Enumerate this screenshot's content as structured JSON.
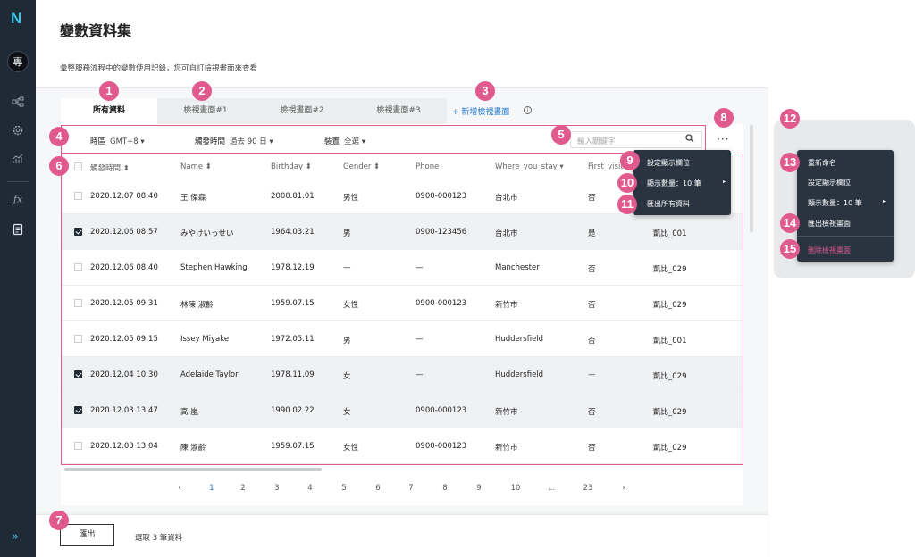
{
  "sidebar": {
    "logo": "N",
    "avatar": "專",
    "icons": [
      "flow-icon",
      "gear-icon",
      "chart-icon",
      "function-icon",
      "document-icon"
    ],
    "expand": "»"
  },
  "header": {
    "title": "變數資料集",
    "description": "彙整服務流程中的變數使用記錄，您可自訂檢視畫面來查看"
  },
  "tabs": [
    {
      "label": "所有資料"
    },
    {
      "label": "檢視畫面#1"
    },
    {
      "label": "檢視畫面#2"
    },
    {
      "label": "檢視畫面#3"
    }
  ],
  "add_view": "+ 新增檢視畫面",
  "filters": {
    "tz_label": "時區",
    "tz_value": "GMT+8 ▾",
    "time_label": "觸發時間",
    "time_value": "過去 90 日 ▾",
    "device_label": "裝置",
    "device_value": "全選 ▾"
  },
  "search": {
    "placeholder": "輸入關鍵字"
  },
  "more": "···",
  "table": {
    "headers": [
      "觸發時間 ⬍",
      "Name ⬍",
      "Birthday ⬍",
      "Gender ⬍",
      "Phone",
      "Where_you_stay ▾",
      "First_visit"
    ],
    "rows": [
      {
        "checked": false,
        "time": "2020.12.07  08:40",
        "name": "王 傑森",
        "birthday": "2000.01.01",
        "gender": "男性",
        "phone": "0900-000123",
        "stay": "台北市",
        "first": "否",
        "extra": ""
      },
      {
        "checked": true,
        "time": "2020.12.06  08:57",
        "name": "みやけいっせい",
        "birthday": "1964.03.21",
        "gender": "男",
        "phone": "0900-123456",
        "stay": "台北市",
        "first": "是",
        "extra": "凱比_001"
      },
      {
        "checked": false,
        "time": "2020.12.06  08:40",
        "name": "Stephen Hawking",
        "birthday": "1978.12.19",
        "gender": "—",
        "phone": "—",
        "stay": "Manchester",
        "first": "否",
        "extra": "凱比_029"
      },
      {
        "checked": false,
        "time": "2020.12.05  09:31",
        "name": "林陳 淑齡",
        "birthday": "1959.07.15",
        "gender": "女性",
        "phone": "0900-000123",
        "stay": "新竹市",
        "first": "否",
        "extra": "凱比_029"
      },
      {
        "checked": false,
        "time": "2020.12.05  09:15",
        "name": "Issey Miyake",
        "birthday": "1972.05.11",
        "gender": "男",
        "phone": "—",
        "stay": "Huddersfield",
        "first": "否",
        "extra": "凱比_001"
      },
      {
        "checked": true,
        "time": "2020.12.04  10:30",
        "name": "Adelaide Taylor",
        "birthday": "1978.11.09",
        "gender": "女",
        "phone": "—",
        "stay": "Huddersfield",
        "first": "—",
        "extra": "凱比_029"
      },
      {
        "checked": true,
        "time": "2020.12.03  13:47",
        "name": "高 嵐",
        "birthday": "1990.02.22",
        "gender": "女",
        "phone": "0900-000123",
        "stay": "新竹市",
        "first": "否",
        "extra": "凱比_029"
      },
      {
        "checked": false,
        "time": "2020.12.03  13:04",
        "name": "陳 淑齡",
        "birthday": "1959.07.15",
        "gender": "女性",
        "phone": "0900-000123",
        "stay": "新竹市",
        "first": "否",
        "extra": "凱比_029"
      }
    ]
  },
  "pagination": {
    "prev": "‹",
    "pages": [
      "1",
      "2",
      "3",
      "4",
      "5",
      "6",
      "7",
      "8",
      "9",
      "10",
      "...",
      "23"
    ],
    "next": "›"
  },
  "footer": {
    "export": "匯出",
    "selected": "選取 3 筆資料"
  },
  "menu_more": [
    "設定顯示欄位",
    "顯示數量：10 筆",
    "匯出所有資料"
  ],
  "menu_view": [
    "重新命名",
    "設定顯示欄位",
    "顯示數量：10 筆",
    "匯出檢視畫面",
    "刪除檢視畫面"
  ],
  "badges": [
    "1",
    "2",
    "3",
    "4",
    "5",
    "6",
    "7",
    "8",
    "9",
    "10",
    "11",
    "12",
    "13",
    "14",
    "15"
  ],
  "colors": {
    "accent": "#e05a8e",
    "link": "#1a73c9",
    "sidebar": "#1f2a37",
    "danger": "#e05a8e"
  }
}
